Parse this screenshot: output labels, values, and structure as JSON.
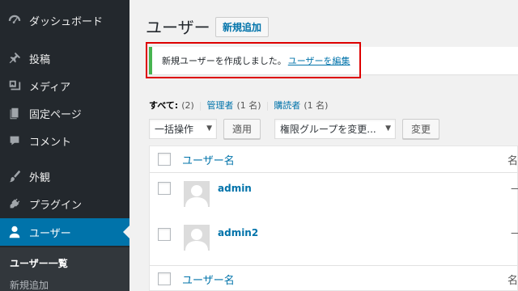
{
  "sidebar": {
    "items": [
      {
        "label": "ダッシュボード",
        "icon": "dashboard-icon"
      },
      {
        "label": "投稿",
        "icon": "pin-icon"
      },
      {
        "label": "メディア",
        "icon": "media-icon"
      },
      {
        "label": "固定ページ",
        "icon": "page-icon"
      },
      {
        "label": "コメント",
        "icon": "comment-icon"
      },
      {
        "label": "外観",
        "icon": "brush-icon"
      },
      {
        "label": "プラグイン",
        "icon": "plugin-icon"
      },
      {
        "label": "ユーザー",
        "icon": "user-icon"
      }
    ],
    "submenu": [
      {
        "label": "ユーザー一覧"
      },
      {
        "label": "新規追加"
      }
    ]
  },
  "header": {
    "title": "ユーザー",
    "add_new_label": "新規追加"
  },
  "notice": {
    "text": "新規ユーザーを作成しました。",
    "link": "ユーザーを編集"
  },
  "filters": {
    "all_label": "すべて:",
    "all_count": "(2)",
    "admin_label": "管理者",
    "admin_count": "(1 名)",
    "subscriber_label": "購読者",
    "subscriber_count": "(1 名)",
    "separator": "|"
  },
  "bulk": {
    "action_label": "一括操作",
    "apply_label": "適用",
    "role_label": "権限グループを変更...",
    "change_label": "変更"
  },
  "table": {
    "col_username": "ユーザー名",
    "col_name_trunc": "名",
    "rows": [
      {
        "username": "admin",
        "name": "—"
      },
      {
        "username": "admin2",
        "name": "—"
      }
    ]
  },
  "colors": {
    "sidebar_bg": "#23282d",
    "active": "#0073aa",
    "link": "#0073aa",
    "notice_border": "#46b450",
    "highlight": "#dd0000"
  }
}
